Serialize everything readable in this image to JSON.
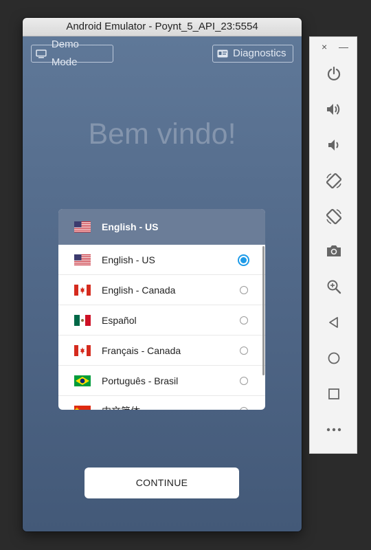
{
  "window": {
    "title": "Android Emulator - Poynt_5_API_23:5554"
  },
  "app": {
    "demo_mode_label": "Demo Mode",
    "diagnostics_label": "Diagnostics",
    "welcome": "Bem vindo!",
    "selected_language": {
      "label": "English - US",
      "flag": "us-flag"
    },
    "languages": [
      {
        "label": "English - US",
        "flag": "us-flag",
        "selected": true
      },
      {
        "label": "English - Canada",
        "flag": "canada-flag",
        "selected": false
      },
      {
        "label": "Español",
        "flag": "mexico-flag",
        "selected": false
      },
      {
        "label": "Français - Canada",
        "flag": "canada-flag",
        "selected": false
      },
      {
        "label": "Português - Brasil",
        "flag": "brazil-flag",
        "selected": false
      },
      {
        "label": "中文简体",
        "flag": "china-flag",
        "selected": false
      }
    ],
    "continue_label": "CONTINUE",
    "accent_color": "#1e9be8"
  },
  "toolbar": {
    "close_label": "×",
    "minimize_label": "—",
    "buttons": [
      "power-icon",
      "volume-up-icon",
      "volume-down-icon",
      "rotate-left-icon",
      "rotate-right-icon",
      "camera-icon",
      "zoom-icon",
      "back-icon",
      "home-icon",
      "overview-icon",
      "more-icon"
    ]
  }
}
